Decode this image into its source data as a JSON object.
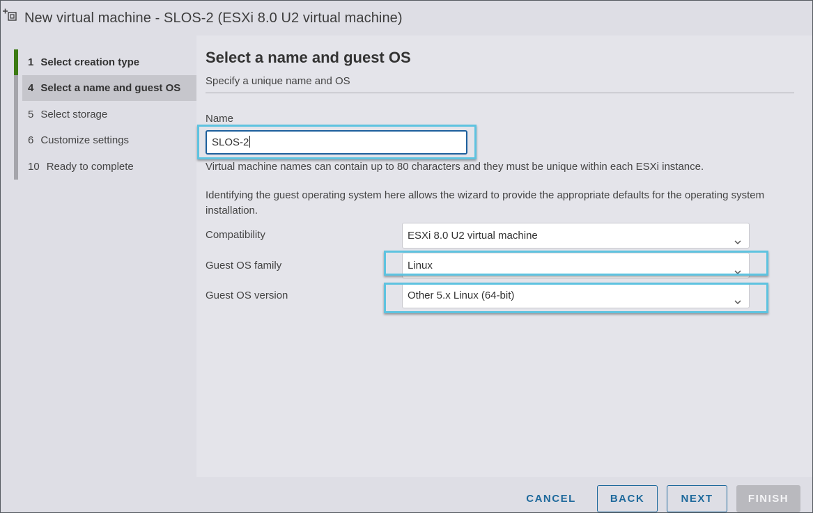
{
  "window": {
    "title": "New virtual machine - SLOS-2 (ESXi 8.0 U2 virtual machine)",
    "icon": "new-vm-icon"
  },
  "wizard": {
    "steps": [
      {
        "number": "1",
        "label": "Select creation type",
        "state": "completed"
      },
      {
        "number": "4",
        "label": "Select a name and guest OS",
        "state": "active"
      },
      {
        "number": "5",
        "label": "Select storage",
        "state": "pending"
      },
      {
        "number": "6",
        "label": "Customize settings",
        "state": "pending"
      },
      {
        "number": "10",
        "label": "Ready to complete",
        "state": "pending"
      }
    ]
  },
  "page": {
    "title": "Select a name and guest OS",
    "subtitle": "Specify a unique name and OS",
    "name": {
      "label": "Name",
      "value": "SLOS-2",
      "helper": "Virtual machine names can contain up to 80 characters and they must be unique within each ESXi instance."
    },
    "guest_os_paragraph": "Identifying the guest operating system here allows the wizard to provide the appropriate defaults for the operating system installation.",
    "compatibility": {
      "label": "Compatibility",
      "value": "ESXi 8.0 U2 virtual machine"
    },
    "guest_os_family": {
      "label": "Guest OS family",
      "value": "Linux"
    },
    "guest_os_version": {
      "label": "Guest OS version",
      "value": "Other 5.x Linux (64-bit)"
    }
  },
  "footer": {
    "cancel_label": "CANCEL",
    "back_label": "BACK",
    "next_label": "NEXT",
    "finish_label": "FINISH"
  },
  "colors": {
    "accent": "#1f6a9c",
    "progress": "#3c7a12",
    "highlight": "#5ec3e0"
  }
}
